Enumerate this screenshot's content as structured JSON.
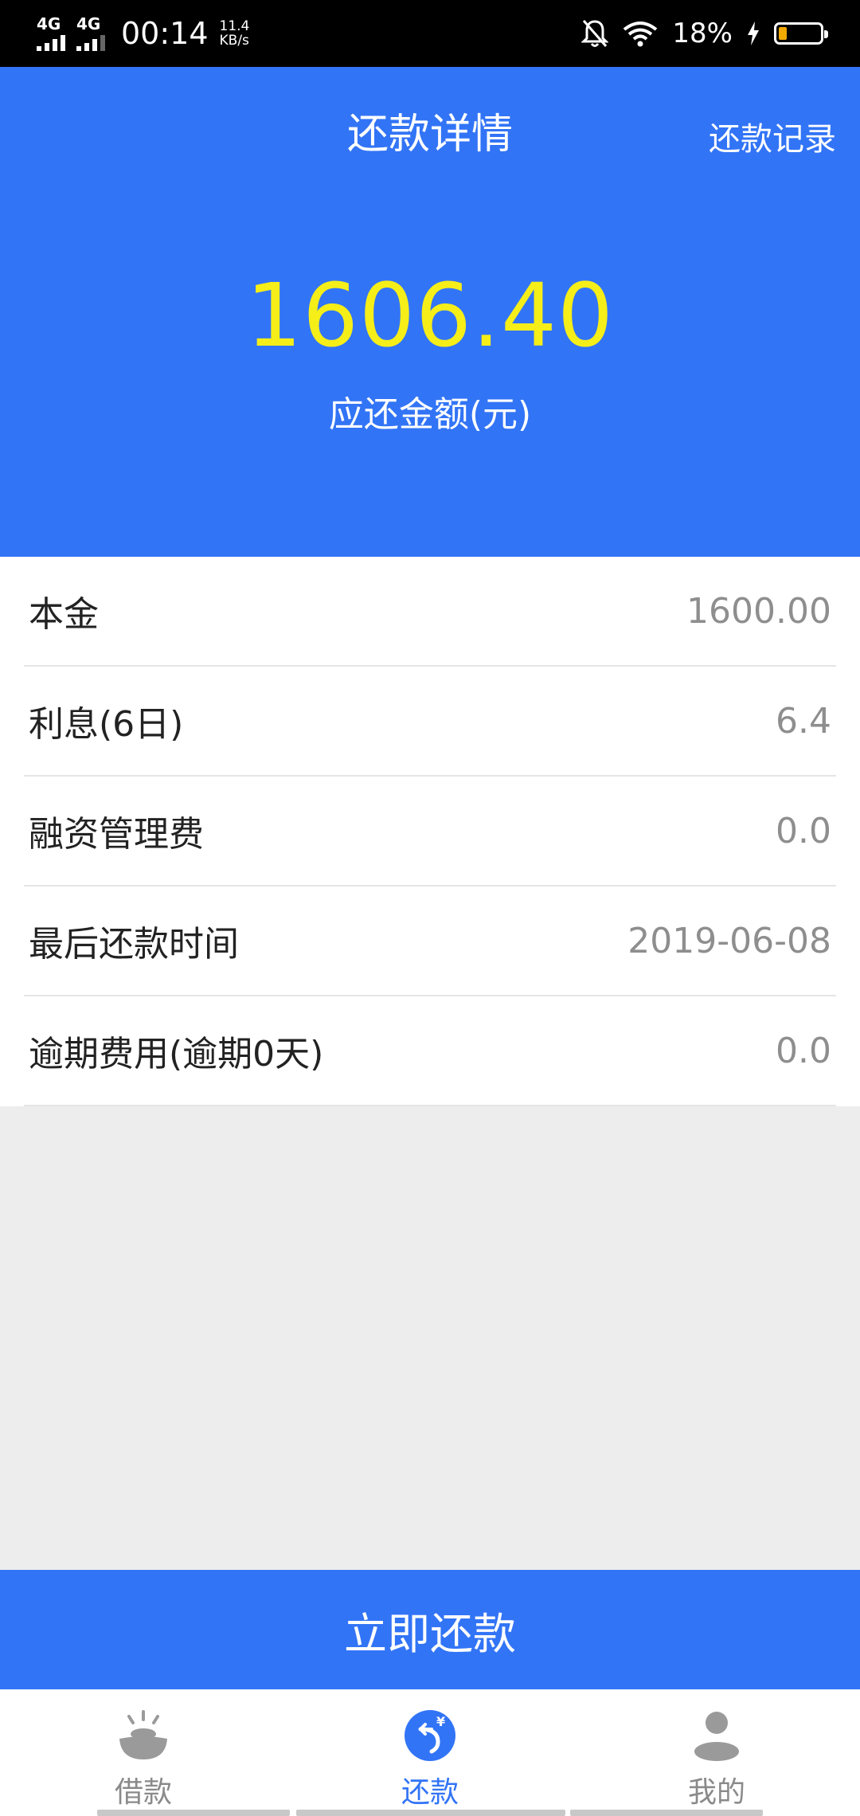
{
  "status_bar": {
    "network_1": "4G",
    "network_2": "4G",
    "time": "00:14",
    "speed_value": "11.4",
    "speed_unit": "KB/s",
    "battery_percent": "18%"
  },
  "header": {
    "title": "还款详情",
    "records_link": "还款记录"
  },
  "summary": {
    "amount": "1606.40",
    "caption": "应还金额(元)",
    "amount_color": "#f5ee18"
  },
  "details": [
    {
      "label": "本金",
      "value": "1600.00"
    },
    {
      "label": "利息(6日)",
      "value": "6.4"
    },
    {
      "label": "融资管理费",
      "value": "0.0"
    },
    {
      "label": "最后还款时间",
      "value": "2019-06-08"
    },
    {
      "label": "逾期费用(逾期0天)",
      "value": "0.0"
    }
  ],
  "pay_button": "立即还款",
  "tabs": [
    {
      "label": "借款",
      "icon": "borrow-icon",
      "active": false
    },
    {
      "label": "还款",
      "icon": "repay-icon",
      "active": true
    },
    {
      "label": "我的",
      "icon": "profile-icon",
      "active": false
    }
  ],
  "colors": {
    "brand": "#3274f6",
    "background": "#ededed"
  }
}
